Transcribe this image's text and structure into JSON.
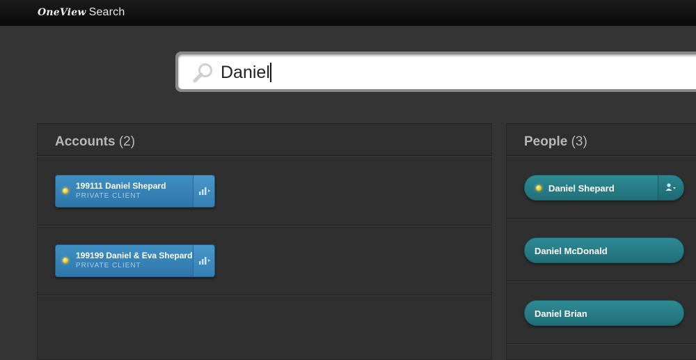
{
  "app": {
    "brand": "OneView",
    "title": "Search"
  },
  "search": {
    "value": "Daniel"
  },
  "accounts": {
    "heading": "Accounts",
    "count": "(2)",
    "items": [
      {
        "number": "199111",
        "name": "Daniel Shepard",
        "type": "PRIVATE CLIENT"
      },
      {
        "number": "199199",
        "name": "Daniel & Eva Shepard",
        "type": "PRIVATE CLIENT"
      }
    ]
  },
  "people": {
    "heading": "People",
    "count": "(3)",
    "items": [
      {
        "name": "Daniel Shepard"
      },
      {
        "name": "Daniel McDonald"
      },
      {
        "name": "Daniel Brian"
      }
    ]
  },
  "colors": {
    "account_chip": "#3585ba",
    "person_chip": "#27808a",
    "status_dot": "#f3c21a"
  },
  "icons": {
    "search": "magnifier-icon",
    "account_action": "bar-chart-icon",
    "person_action": "person-icon"
  }
}
